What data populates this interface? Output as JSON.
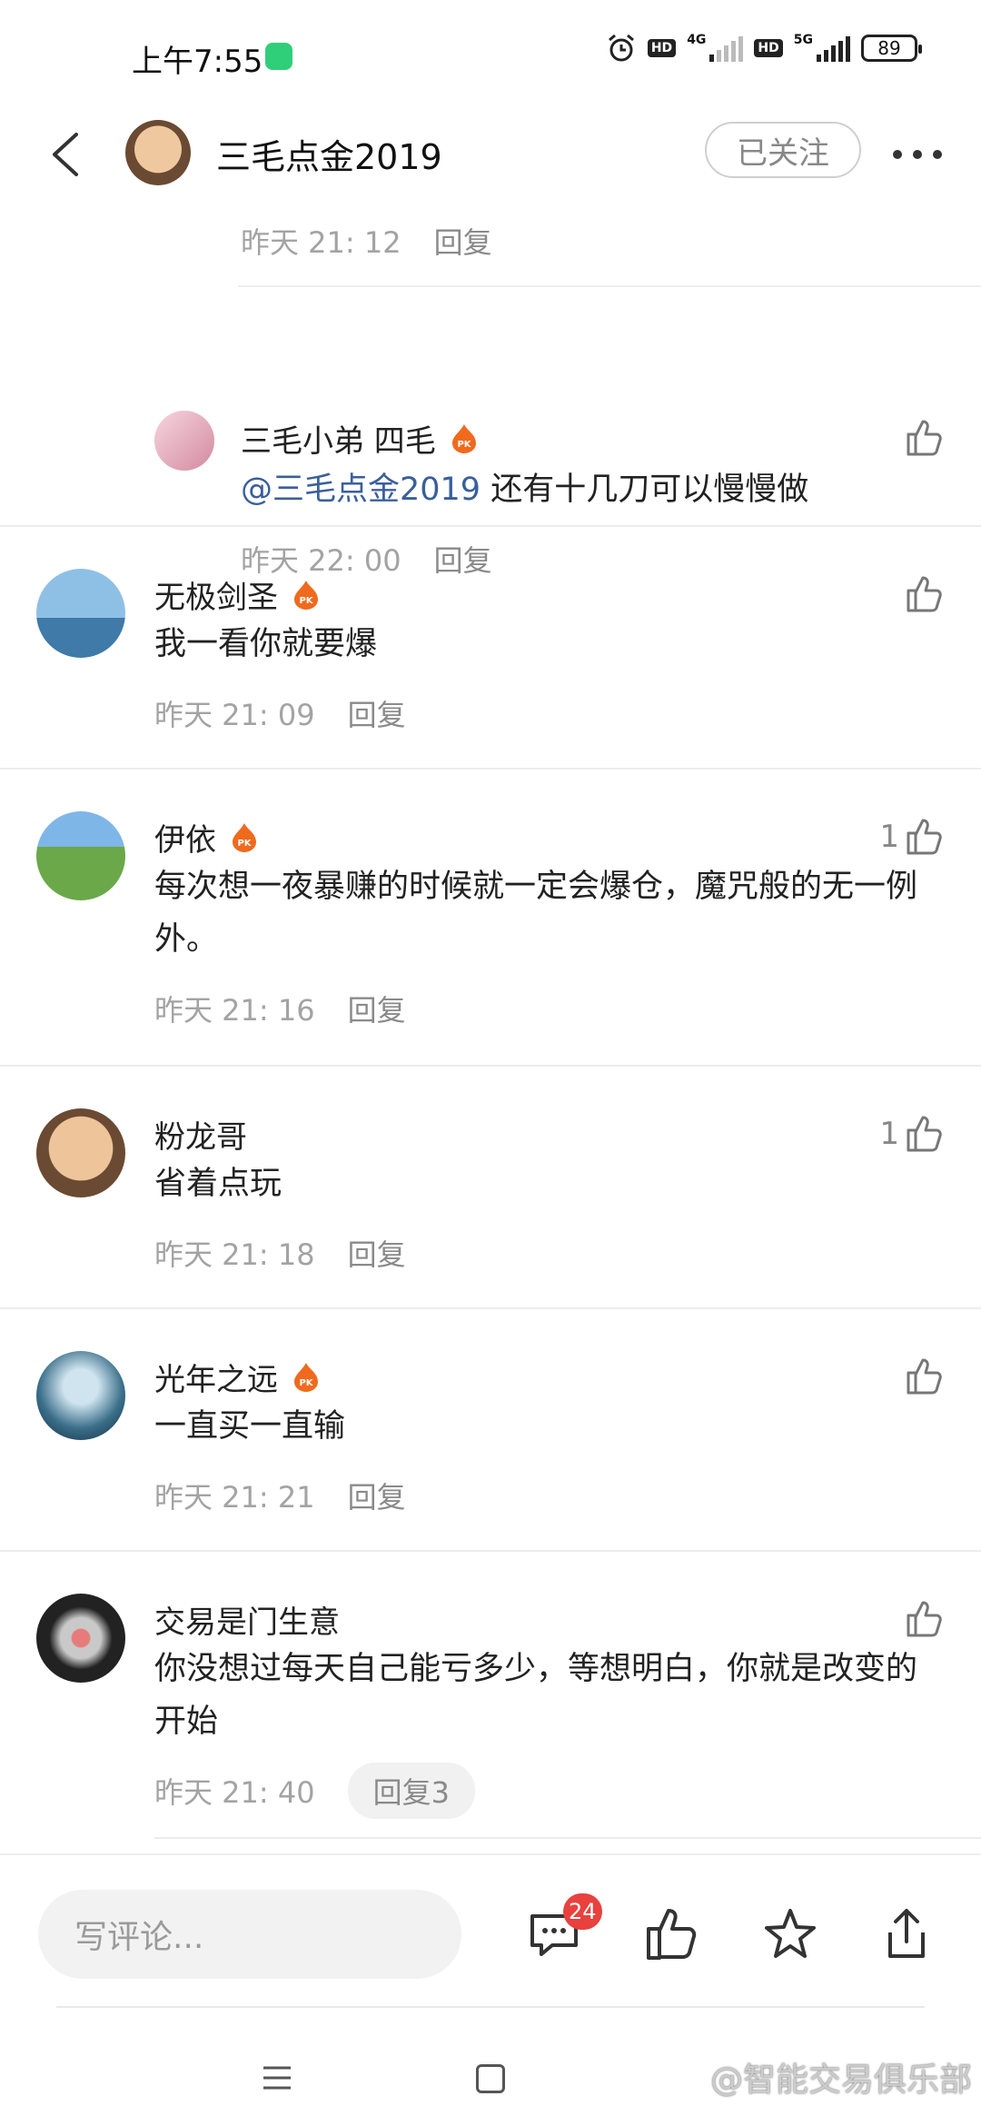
{
  "status_bar": {
    "time": "上午7:55",
    "hd1": "HD",
    "net1": "4G",
    "hd2": "HD",
    "net2": "5G",
    "battery": "89"
  },
  "header": {
    "title": "三毛点金2019",
    "follow_label": "已关注"
  },
  "top_reply": {
    "time": "昨天 21: 12",
    "reply_label": "回复"
  },
  "comments": [
    {
      "user": "三毛小弟 四毛",
      "mention": "@三毛点金2019",
      "text": " 还有十几刀可以慢慢做",
      "time": "昨天 22: 00",
      "reply_label": "回复",
      "likes": ""
    },
    {
      "user": "无极剑圣",
      "text": "我一看你就要爆",
      "time": "昨天 21: 09",
      "reply_label": "回复",
      "likes": ""
    },
    {
      "user": "伊依",
      "text": "每次想一夜暴赚的时候就一定会爆仓，魔咒般的无一例外。",
      "time": "昨天 21: 16",
      "reply_label": "回复",
      "likes": "1"
    },
    {
      "user": "粉龙哥",
      "text": "省着点玩",
      "time": "昨天 21: 18",
      "reply_label": "回复",
      "likes": "1"
    },
    {
      "user": "光年之远",
      "text": "一直买一直输",
      "time": "昨天 21: 21",
      "reply_label": "回复",
      "likes": ""
    },
    {
      "user": "交易是门生意",
      "text": "你没想过每天自己能亏多少，等想明白，你就是改变的开始",
      "time": "昨天 21: 40",
      "reply_label": "回复3",
      "likes": ""
    }
  ],
  "bottom_bar": {
    "input_placeholder": "写评论...",
    "comment_count": "24"
  },
  "watermark": "@智能交易俱乐部",
  "colors": {
    "mention": "#3a5f9a",
    "badge": "#e8413e",
    "pk_badge": "#f06a1e"
  }
}
